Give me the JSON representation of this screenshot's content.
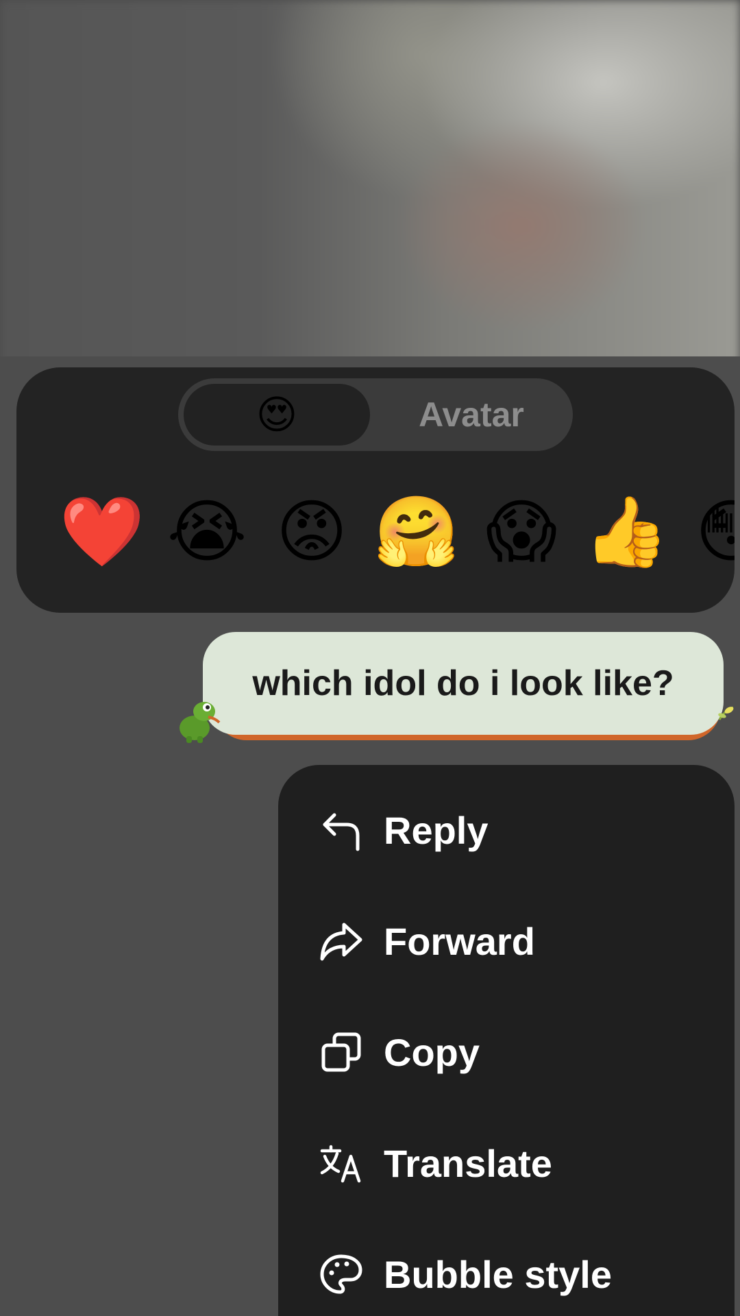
{
  "reactions": {
    "tabs": [
      {
        "label": "😍",
        "active": true
      },
      {
        "label": "Avatar",
        "active": false
      }
    ],
    "emojis": [
      "❤️",
      "😭",
      "😡",
      "🤗",
      "😱",
      "👍",
      "😳"
    ]
  },
  "message": {
    "text": "which idol do i look like?"
  },
  "menu": {
    "items": [
      {
        "label": "Reply",
        "icon": "reply-icon"
      },
      {
        "label": "Forward",
        "icon": "forward-icon"
      },
      {
        "label": "Copy",
        "icon": "copy-icon"
      },
      {
        "label": "Translate",
        "icon": "translate-icon"
      },
      {
        "label": "Bubble style",
        "icon": "palette-icon"
      }
    ]
  },
  "colors": {
    "panel": "#232323",
    "menu": "#1f1f1f",
    "bubble": "#dde7d8",
    "bubble_accent": "#d0662a"
  }
}
